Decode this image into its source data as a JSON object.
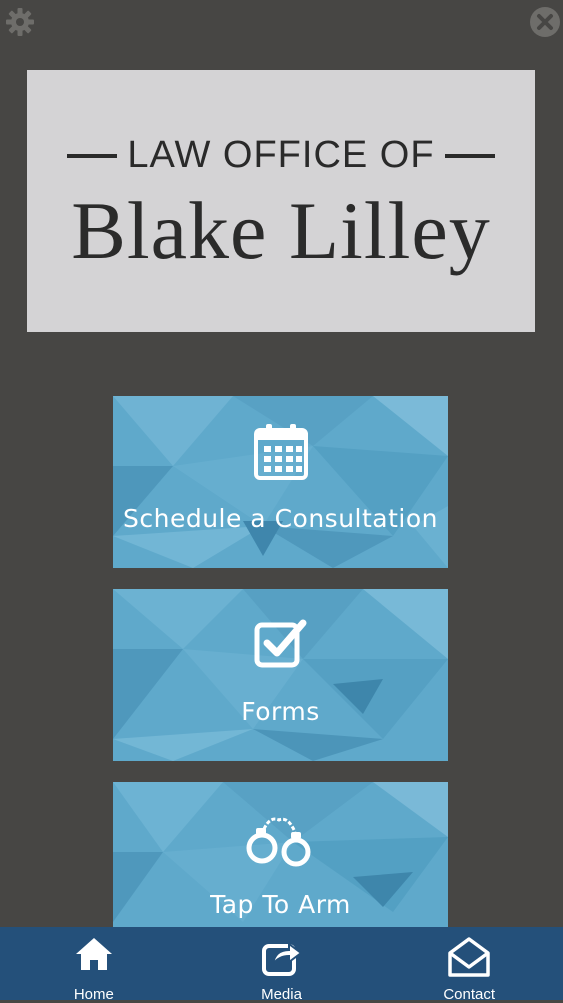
{
  "logo": {
    "line1": "LAW OFFICE OF",
    "line2": "Blake Lilley"
  },
  "header": {
    "left_icon": "gear-icon",
    "right_icon": "close-icon"
  },
  "tiles": [
    {
      "label": "Schedule a Consultation",
      "icon": "calendar-icon"
    },
    {
      "label": "Forms",
      "icon": "checkbox-icon"
    },
    {
      "label": "Tap To Arm",
      "icon": "handcuffs-icon"
    }
  ],
  "tabbar": {
    "items": [
      {
        "label": "Home",
        "icon": "home-icon"
      },
      {
        "label": "Media",
        "icon": "share-icon"
      },
      {
        "label": "Contact",
        "icon": "envelope-icon"
      }
    ]
  },
  "colors": {
    "background": "#474644",
    "logo_box": "#d4d3d5",
    "tile": "#5ea9cb",
    "tabbar": "#24507a"
  }
}
